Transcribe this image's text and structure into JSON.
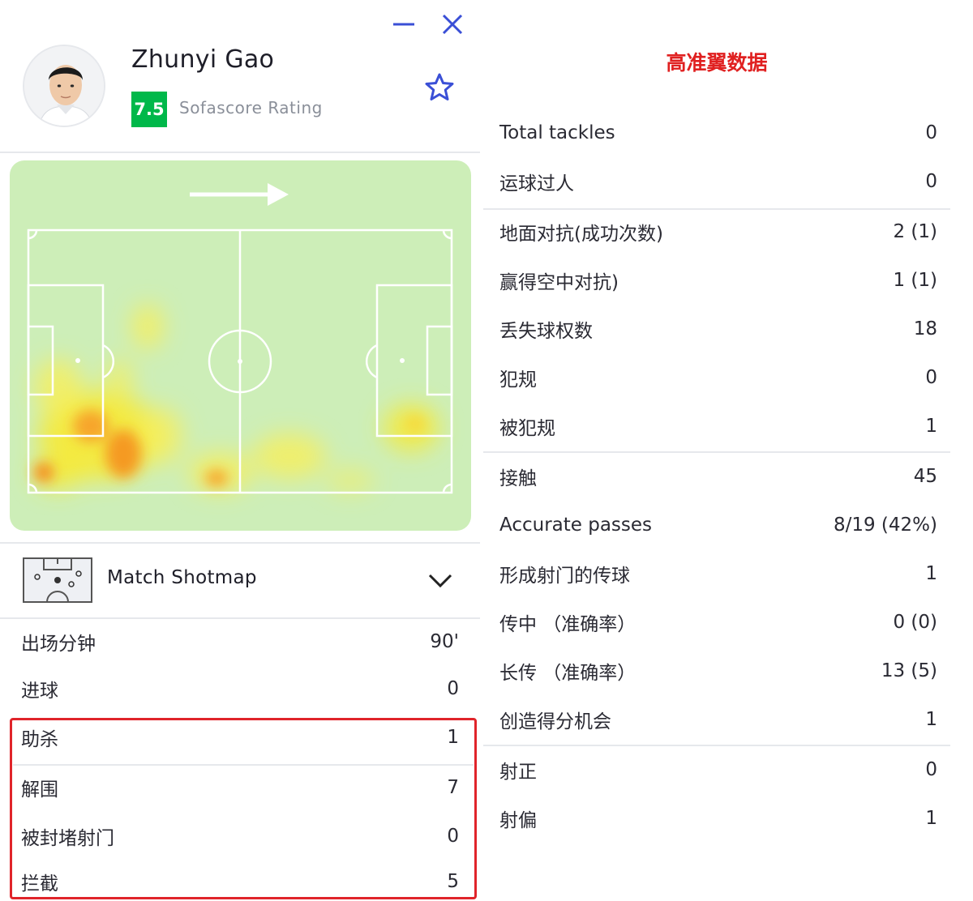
{
  "player": {
    "name": "Zhunyi Gao",
    "rating": "7.5",
    "rating_label": "Sofascore Rating"
  },
  "window_icons": {
    "minimize": "minimize-icon",
    "close": "close-icon",
    "favorite": "star-icon"
  },
  "heatmap": {
    "attack_direction": "right"
  },
  "shotmap": {
    "label": "Match Shotmap",
    "icon": "shotmap-pitch-icon",
    "toggle_icon": "chevron-down-icon"
  },
  "left_stats": [
    {
      "label": "出场分钟",
      "value": "90'"
    },
    {
      "label": "进球",
      "value": "0"
    },
    {
      "label": "助杀",
      "value": "1"
    },
    {
      "label": "解围",
      "value": "7"
    },
    {
      "label": "被封堵射门",
      "value": "0"
    },
    {
      "label": "拦截",
      "value": "5"
    }
  ],
  "right_panel": {
    "title": "高准翼数据",
    "title_color": "#e02020",
    "stats": [
      {
        "label": "Total tackles",
        "value": "0"
      },
      {
        "label": "运球过人",
        "value": "0"
      },
      {
        "label": "地面对抗(成功次数)",
        "value": "2 (1)"
      },
      {
        "label": "赢得空中对抗)",
        "value": "1 (1)"
      },
      {
        "label": "丢失球权数",
        "value": "18"
      },
      {
        "label": "犯规",
        "value": "0"
      },
      {
        "label": "被犯规",
        "value": "1"
      },
      {
        "label": "接触",
        "value": "45"
      },
      {
        "label": "Accurate passes",
        "value": "8/19 (42%)"
      },
      {
        "label": "形成射门的传球",
        "value": "1"
      },
      {
        "label": "传中 （准确率）",
        "value": "0 (0)"
      },
      {
        "label": "长传 （准确率）",
        "value": "13 (5)"
      },
      {
        "label": "创造得分机会",
        "value": "1"
      },
      {
        "label": "射正",
        "value": "0"
      },
      {
        "label": "射偏",
        "value": "1"
      }
    ]
  },
  "colors": {
    "rating_badge": "#00b84a",
    "highlight_border": "#e0242a",
    "pitch": "#cdeeb8",
    "accent_icon": "#3a4fd6"
  }
}
